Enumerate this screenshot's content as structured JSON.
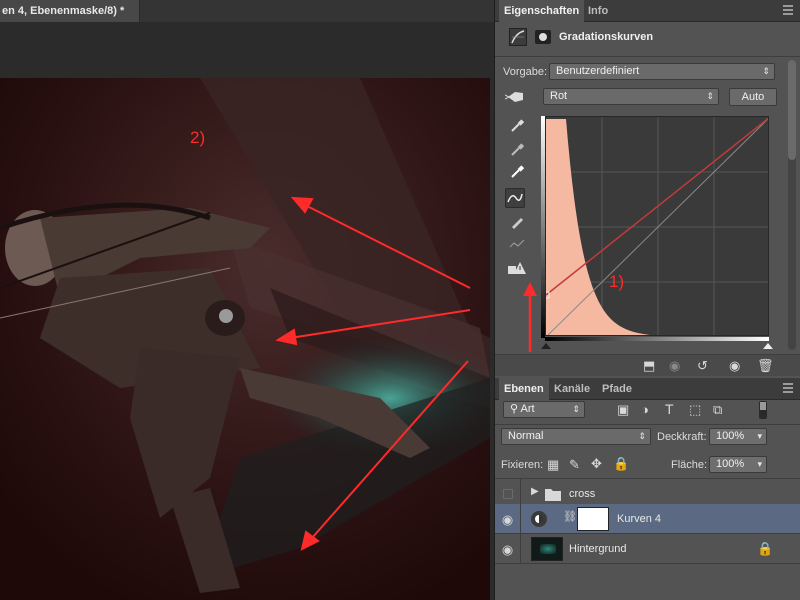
{
  "document": {
    "tab_title": "en 4, Ebenenmaske/8) *"
  },
  "annotations": {
    "label_1": "1)",
    "label_2": "2)",
    "color": "#ff2a2a"
  },
  "properties_panel": {
    "tabs": [
      "Eigenschaften",
      "Info"
    ],
    "title": "Gradationskurven",
    "preset_label": "Vorgabe:",
    "preset_value": "Benutzerdefiniert",
    "channel_value": "Rot",
    "auto_button": "Auto"
  },
  "layers_panel": {
    "tabs": [
      "Ebenen",
      "Kanäle",
      "Pfade"
    ],
    "filter_value": "Art",
    "blend_mode": "Normal",
    "opacity_label": "Deckkraft:",
    "opacity_value": "100%",
    "lock_label": "Fixieren:",
    "fill_label": "Fläche:",
    "fill_value": "100%",
    "layers": [
      {
        "name": "cross",
        "type": "group",
        "visible": false,
        "selected": false
      },
      {
        "name": "Kurven 4",
        "type": "adjustment",
        "visible": true,
        "selected": true
      },
      {
        "name": "Hintergrund",
        "type": "image",
        "visible": true,
        "selected": false,
        "locked": true
      }
    ]
  },
  "colors": {
    "panel_bg": "#535353",
    "selection": "#5b6a82",
    "histogram_fill": "#f5b8a0",
    "curve_red": "#c23a3a"
  }
}
